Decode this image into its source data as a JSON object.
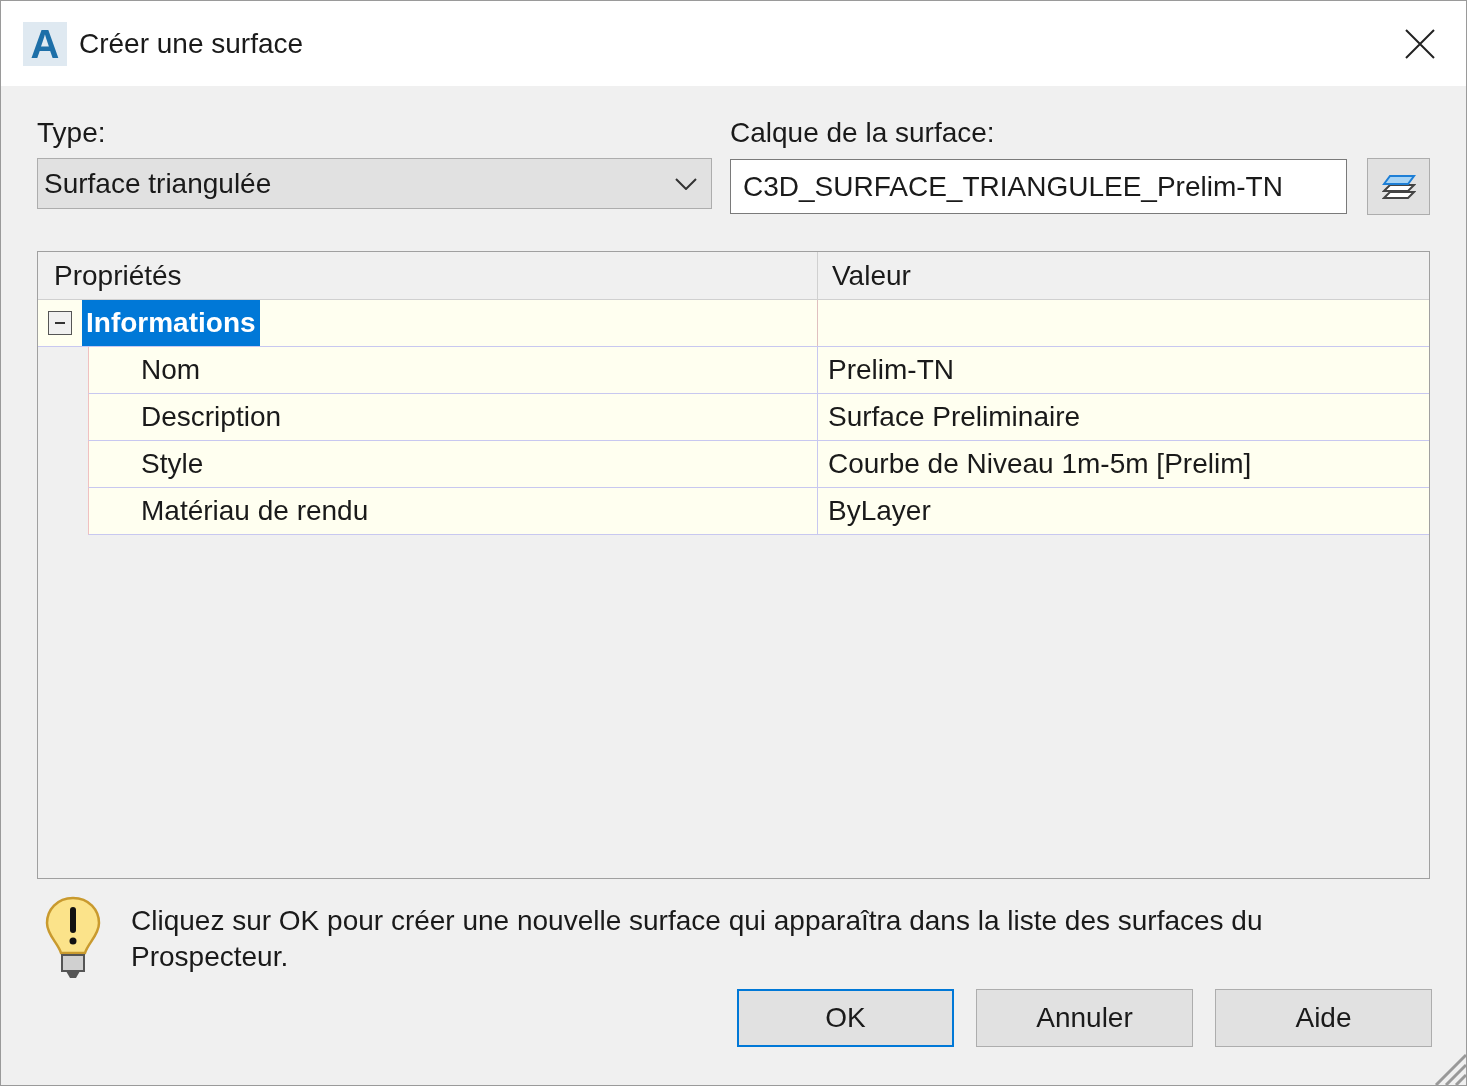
{
  "window": {
    "title": "Créer une surface",
    "icon_letter": "A"
  },
  "type": {
    "label": "Type:",
    "value": "Surface triangulée"
  },
  "layer": {
    "label": "Calque de la surface:",
    "value": "C3D_SURFACE_TRIANGULEE_Prelim-TN"
  },
  "grid": {
    "columns": [
      "Propriétés",
      "Valeur"
    ],
    "groups": [
      {
        "name": "Informations",
        "expanded": true,
        "selected": true,
        "rows": [
          {
            "name": "Nom",
            "value": "Prelim-TN"
          },
          {
            "name": "Description",
            "value": "Surface Preliminaire"
          },
          {
            "name": "Style",
            "value": "Courbe de Niveau 1m-5m [Prelim]"
          },
          {
            "name": "Matériau de rendu",
            "value": "ByLayer"
          }
        ]
      }
    ]
  },
  "hint": "Cliquez sur OK pour créer une nouvelle surface qui apparaîtra dans la liste des surfaces du Prospecteur.",
  "buttons": [
    {
      "label": "OK",
      "default": true
    },
    {
      "label": "Annuler",
      "default": false
    },
    {
      "label": "Aide",
      "default": false
    }
  ]
}
